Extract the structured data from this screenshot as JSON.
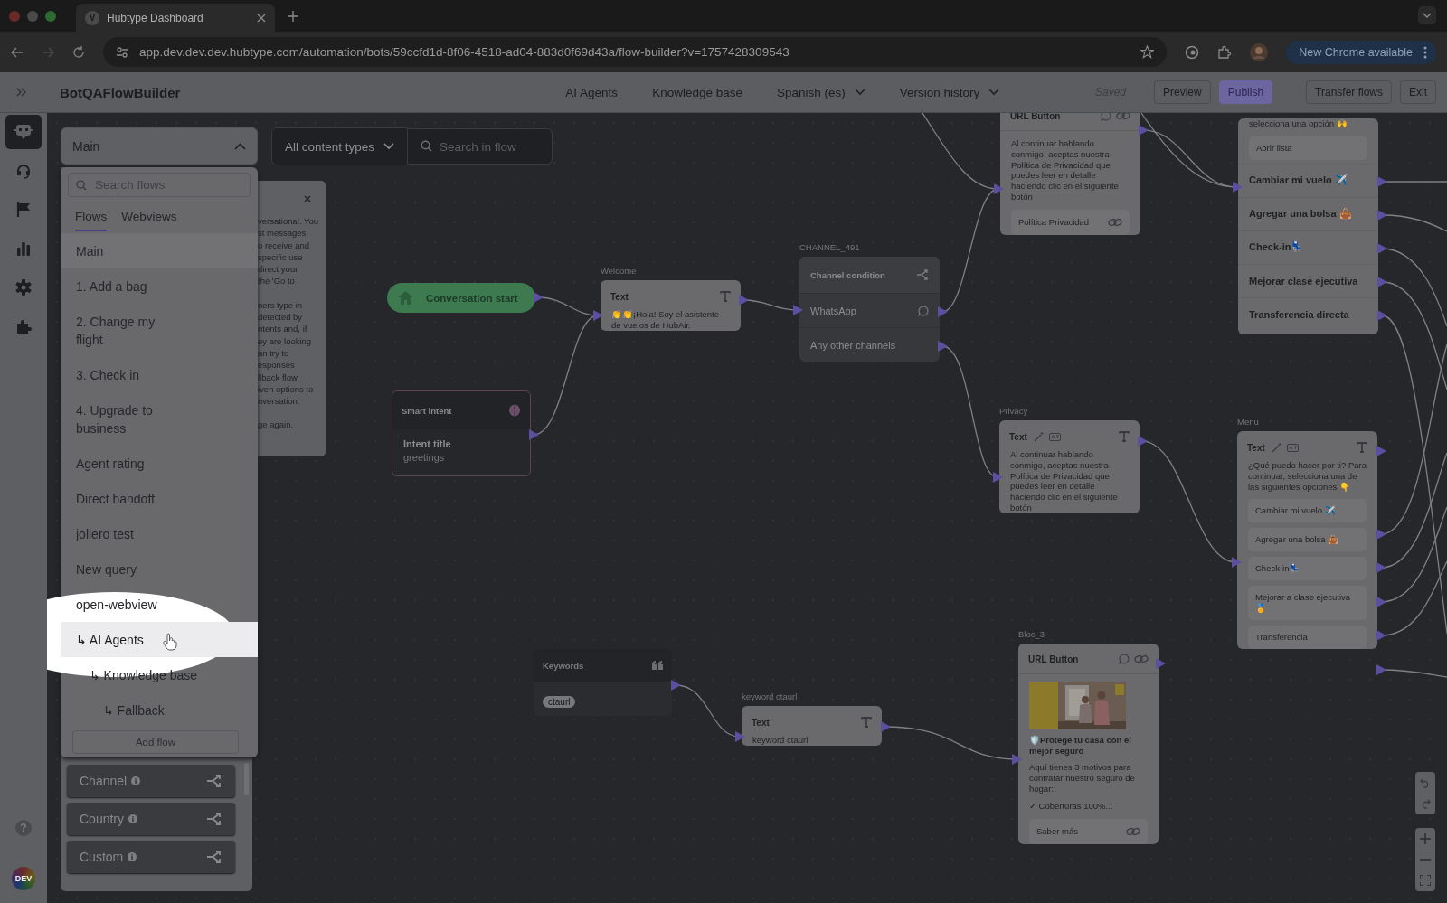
{
  "browser": {
    "favicon_letter": "V",
    "tab_title": "Hubtype Dashboard",
    "url": "app.dev.dev.dev.hubtype.com/automation/bots/59ccfd1d-8f06-4518-ad04-883d0f69d43a/flow-builder?v=1757428309543",
    "update_button": "New Chrome available"
  },
  "header": {
    "bot_name": "BotQAFlowBuilder",
    "nav": [
      {
        "label": "AI Agents",
        "dropdown": false
      },
      {
        "label": "Knowledge base",
        "dropdown": false
      },
      {
        "label": "Spanish (es)",
        "dropdown": true
      },
      {
        "label": "Version history",
        "dropdown": true
      }
    ],
    "status": "Saved",
    "buttons": [
      {
        "label": "Preview",
        "kind": "secondary",
        "disabled": false
      },
      {
        "label": "Publish",
        "kind": "primary",
        "disabled": true
      },
      {
        "label": "Transfer flows",
        "kind": "secondary",
        "disabled": false
      },
      {
        "label": "Exit",
        "kind": "secondary",
        "disabled": false
      }
    ]
  },
  "rail": {
    "items": [
      {
        "selected": true
      },
      {
        "selected": false
      },
      {
        "selected": false
      },
      {
        "selected": false
      },
      {
        "selected": false
      },
      {
        "selected": false
      }
    ],
    "help_label": "?",
    "env_badge": "DEV"
  },
  "flow_selector": {
    "value": "Main",
    "expanded": true
  },
  "flow_menu": {
    "search_placeholder": "Search flows",
    "tabs": [
      {
        "label": "Flows",
        "selected": true
      },
      {
        "label": "Webviews",
        "selected": false
      }
    ],
    "flows": [
      {
        "label": "Main",
        "selected": true,
        "spotlighted": false
      },
      {
        "label": "1. Add a bag",
        "selected": false,
        "spotlighted": false
      },
      {
        "label": "2. Change my flight",
        "selected": false,
        "spotlighted": false
      },
      {
        "label": "3. Check in",
        "selected": false,
        "spotlighted": false
      },
      {
        "label": "4. Upgrade to business",
        "selected": false,
        "spotlighted": false
      },
      {
        "label": "Agent rating",
        "selected": false,
        "spotlighted": false
      },
      {
        "label": "Direct handoff",
        "selected": false,
        "spotlighted": false
      },
      {
        "label": "jollero test",
        "selected": false,
        "spotlighted": false
      },
      {
        "label": "New query",
        "selected": false,
        "spotlighted": false
      },
      {
        "label": "open-webview",
        "selected": false,
        "spotlighted": false
      },
      {
        "label": "AI Agents",
        "prefix": "↳",
        "selected": false,
        "spotlighted": true,
        "children": [
          {
            "label": "Knowledge base",
            "prefix": "↳",
            "selected": false,
            "spotlighted": false,
            "children": [
              {
                "label": "Fallback",
                "prefix": "↳",
                "selected": false,
                "spotlighted": false
              }
            ]
          }
        ]
      }
    ],
    "add_button": "Add flow"
  },
  "content_palette": [
    {
      "label": "Channel"
    },
    {
      "label": "Country"
    },
    {
      "label": "Custom"
    }
  ],
  "info_card": {
    "paragraphs": [
      [
        "versational. You",
        "st messages",
        "o receive and",
        "specific use",
        "direct your",
        "the 'Go to"
      ],
      [
        "ners type in",
        "detected by",
        "ntents and, if",
        "ey are looking",
        "an try to",
        "esponses",
        "llback flow,",
        "iven options to",
        "nversation."
      ],
      [
        "ge again."
      ]
    ]
  },
  "filters": {
    "content_type": "All content types",
    "search_placeholder": "Search in flow"
  },
  "canvas": {
    "nodes": [
      {
        "kind": "start",
        "label": "Conversation start"
      },
      {
        "kind": "text",
        "title": "Welcome",
        "type_label": "Text",
        "ai_tools": false,
        "body": "👏👏¡Hola! Soy el asistente de vuelos de HubAir."
      },
      {
        "kind": "channel_condition",
        "title": "CHANNEL_491",
        "type_label": "Channel condition",
        "options": [
          {
            "label": "WhatsApp",
            "kind": "whatsapp"
          },
          {
            "label": "Any other channels",
            "kind": "other"
          }
        ]
      },
      {
        "kind": "smart_intent",
        "type_label": "Smart intent",
        "field_label": "Intent title",
        "value": "greetings"
      },
      {
        "kind": "url_button",
        "type_label": "URL Button",
        "body": "Al continuar hablando conmigo, aceptas nuestra Política de Privacidad que puedes leer en detalle haciendo clic en el siguiente botón",
        "buttons": [
          "Política Privacidad"
        ]
      },
      {
        "kind": "list",
        "body": "selecciona una opción 🙌",
        "list_button": "Abrir lista",
        "rows": [
          "Cambiar mi vuelo ✈️",
          "Agregar una bolsa 👜",
          "Check-in💺",
          "Mejorar clase ejecutiva",
          "Transferencia directa"
        ]
      },
      {
        "kind": "text",
        "title": "Privacy",
        "type_label": "Text",
        "ai_tools": true,
        "body": "Al continuar hablando conmigo, aceptas nuestra Política de Privacidad que puedes leer en detalle haciendo clic en el siguiente botón"
      },
      {
        "kind": "text",
        "title": "Menu",
        "type_label": "Text",
        "ai_tools": true,
        "body": "¿Qué puedo hacer por ti? Para continuar, selecciona una de las siguientes opciones 👇",
        "buttons": [
          "Cambiar mi vuelo ✈️",
          "Agregar una bolsa 👜",
          "Check-in💺",
          "Mejorar a clase ejecutiva 🏅",
          "Transferencia"
        ]
      },
      {
        "kind": "keywords",
        "type_label": "Keywords",
        "tags": [
          "ctaurl"
        ]
      },
      {
        "kind": "text",
        "title": "keyword ctaurl",
        "type_label": "Text",
        "ai_tools": false,
        "body": "keyword ctaurl"
      },
      {
        "kind": "url_button",
        "title": "Bloc_3",
        "type_label": "URL Button",
        "image": {
          "kind": "picture"
        },
        "headline": "🛡️Protege tu casa con el mejor seguro",
        "body": "Aquí tienes 3 motivos para contratar nuestro seguro de hogar:",
        "extra": "✓ Coberturas 100%...",
        "buttons": [
          "Saber más"
        ]
      }
    ]
  }
}
